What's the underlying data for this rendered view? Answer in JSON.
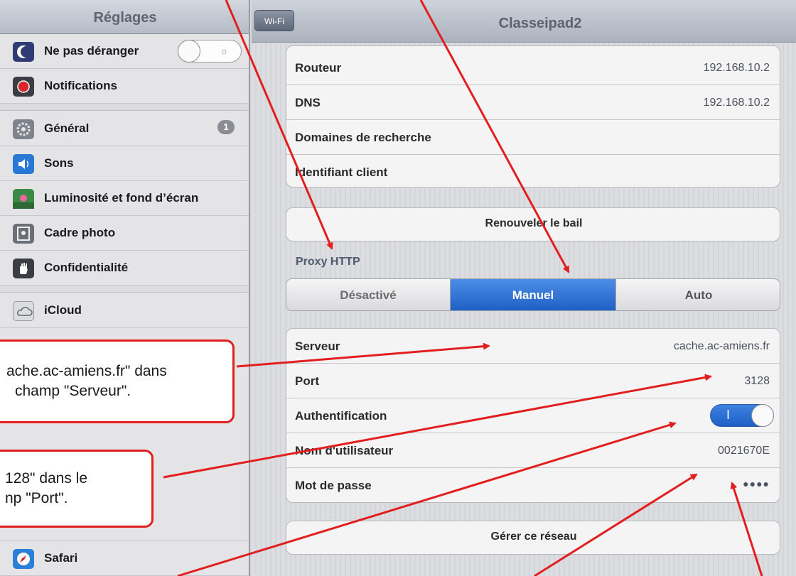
{
  "sidebar": {
    "title": "Réglages",
    "items": [
      {
        "label": "Ne pas déranger",
        "icon": "moon-icon",
        "color": "#2e3b74"
      },
      {
        "label": "Notifications",
        "icon": "notifications-icon",
        "color": "#d8262b"
      },
      {
        "label": "Général",
        "icon": "gear-icon",
        "color": "#7f848c",
        "badge": "1"
      },
      {
        "label": "Sons",
        "icon": "speaker-icon",
        "color": "#2a78d6"
      },
      {
        "label": "Luminosité et fond d’écran",
        "icon": "flower-icon",
        "color": "#3b8b47"
      },
      {
        "label": "Cadre photo",
        "icon": "photo-frame-icon",
        "color": "#6a6f78"
      },
      {
        "label": "Confidentialité",
        "icon": "hand-icon",
        "color": "#3a3d44"
      },
      {
        "label": "iCloud",
        "icon": "cloud-icon",
        "color": "#dcdde0"
      },
      {
        "label": "Safari",
        "icon": "compass-icon",
        "color": "#2c7fd8"
      }
    ]
  },
  "header": {
    "back": "Wi-Fi",
    "title": "Classeipad2"
  },
  "network": {
    "rows": [
      {
        "label": "Routeur",
        "value": "192.168.10.2"
      },
      {
        "label": "DNS",
        "value": "192.168.10.2"
      },
      {
        "label": "Domaines de recherche",
        "value": ""
      },
      {
        "label": "Identifiant client",
        "value": ""
      }
    ],
    "renew": "Renouveler le bail"
  },
  "proxy": {
    "title": "Proxy HTTP",
    "options": [
      "Désactivé",
      "Manuel",
      "Auto"
    ],
    "selected": "Manuel",
    "fields": [
      {
        "label": "Serveur",
        "value": "cache.ac-amiens.fr"
      },
      {
        "label": "Port",
        "value": "3128"
      },
      {
        "label": "Authentification",
        "value": ""
      },
      {
        "label": "Nom d'utilisateur",
        "value": "0021670E"
      },
      {
        "label": "Mot de passe",
        "value": "●●●●"
      }
    ],
    "authentication_on": true
  },
  "manage": "Gérer ce réseau",
  "annotations": {
    "server_note": [
      "ache.ac-amiens.fr\" dans",
      "champ \"Serveur\"."
    ],
    "port_note": [
      "128\" dans le",
      "np \"Port\"."
    ],
    "arrow_color": "#e21e1e"
  }
}
